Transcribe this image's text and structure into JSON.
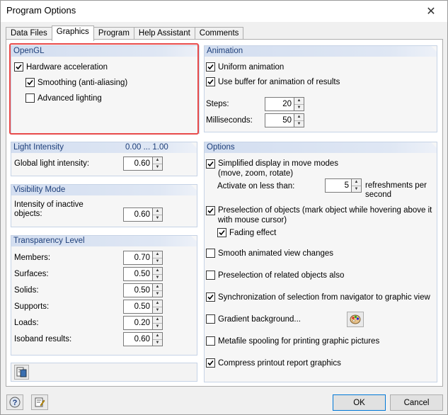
{
  "window": {
    "title": "Program Options"
  },
  "tabs": [
    "Data Files",
    "Graphics",
    "Program",
    "Help Assistant",
    "Comments"
  ],
  "active_tab": "Graphics",
  "opengl": {
    "title": "OpenGL",
    "hardware_acceleration": {
      "label": "Hardware acceleration",
      "checked": true
    },
    "smoothing": {
      "label": "Smoothing (anti-aliasing)",
      "checked": true
    },
    "advanced_lighting": {
      "label": "Advanced lighting",
      "checked": false
    }
  },
  "light_intensity": {
    "title": "Light Intensity",
    "range": "0.00 ... 1.00",
    "global_label": "Global light intensity:",
    "global_value": "0.60"
  },
  "visibility_mode": {
    "title": "Visibility Mode",
    "inactive_label_line1": "Intensity of inactive",
    "inactive_label_line2": "objects:",
    "inactive_value": "0.60"
  },
  "transparency": {
    "title": "Transparency Level",
    "items": [
      {
        "label": "Members:",
        "value": "0.70"
      },
      {
        "label": "Surfaces:",
        "value": "0.50"
      },
      {
        "label": "Solids:",
        "value": "0.50"
      },
      {
        "label": "Supports:",
        "value": "0.50"
      },
      {
        "label": "Loads:",
        "value": "0.20"
      },
      {
        "label": "Isoband results:",
        "value": "0.60"
      }
    ]
  },
  "animation": {
    "title": "Animation",
    "uniform": {
      "label": "Uniform animation",
      "checked": true
    },
    "use_buffer": {
      "label": "Use buffer for animation of results",
      "checked": true
    },
    "steps_label": "Steps:",
    "steps_value": "20",
    "ms_label": "Milliseconds:",
    "ms_value": "50"
  },
  "options": {
    "title": "Options",
    "simplified": {
      "label": "Simplified display in move modes",
      "sub": "(move, zoom, rotate)",
      "checked": true
    },
    "activate_label": "Activate on less than:",
    "activate_value": "5",
    "refresh_line1": "refreshments per",
    "refresh_line2": "second",
    "preselection": {
      "label": "Preselection of objects (mark object while hovering above it",
      "sub": "with mouse cursor)",
      "checked": true
    },
    "fading": {
      "label": "Fading effect",
      "checked": true
    },
    "smooth": {
      "label": "Smooth animated view changes",
      "checked": false
    },
    "preselection_related": {
      "label": "Preselection of related objects also",
      "checked": false
    },
    "sync": {
      "label": "Synchronization of selection from navigator to graphic view",
      "checked": true
    },
    "gradient": {
      "label": "Gradient background...",
      "checked": false
    },
    "metafile": {
      "label": "Metafile spooling for printing graphic pictures",
      "checked": false
    },
    "compress": {
      "label": "Compress printout report graphics",
      "checked": true
    }
  },
  "buttons": {
    "ok": "OK",
    "cancel": "Cancel"
  },
  "colors": {
    "highlight": "#e84a4a",
    "group_header": "#d3def0",
    "header_text": "#1e3f7a"
  }
}
